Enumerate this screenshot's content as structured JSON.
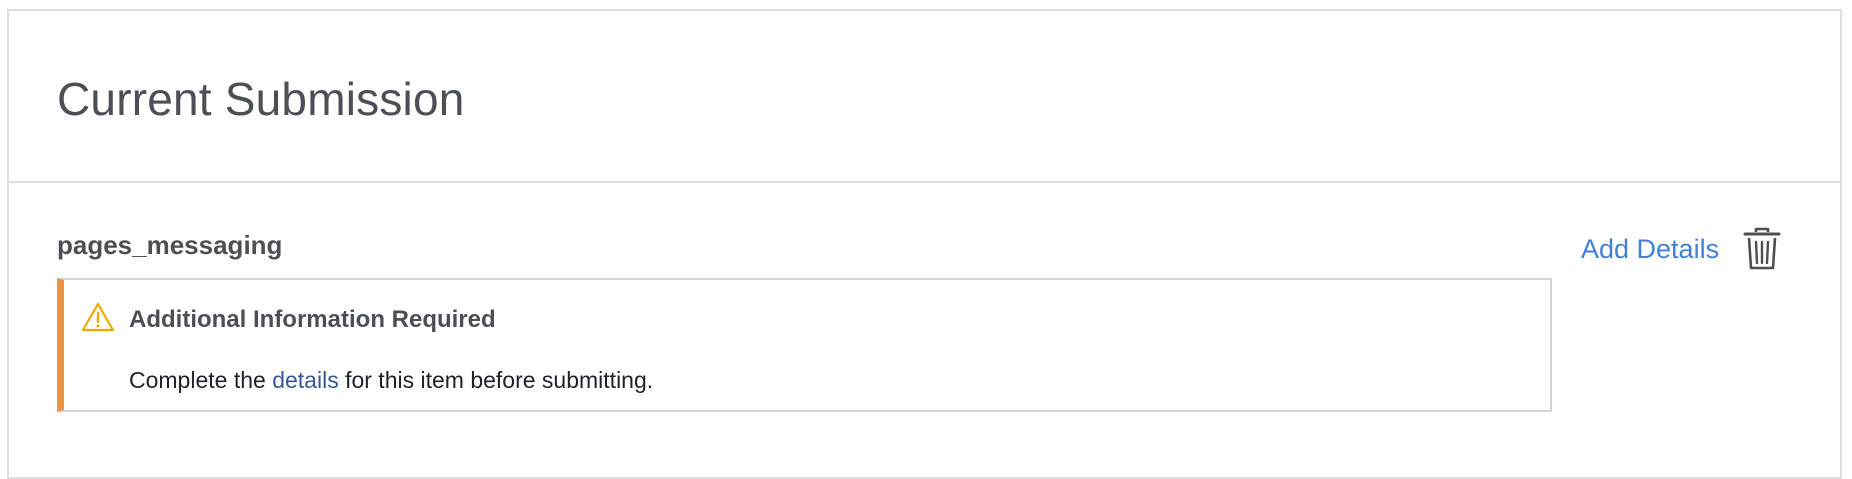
{
  "header": {
    "title": "Current Submission"
  },
  "item": {
    "name": "pages_messaging",
    "notice": {
      "icon": "warning-icon",
      "title": "Additional Information Required",
      "body_before": "Complete the ",
      "body_link": "details",
      "body_after": " for this item before submitting."
    },
    "actions": {
      "add_details_label": "Add Details",
      "delete_icon": "trash-icon"
    }
  },
  "colors": {
    "warning_accent": "#e8954a",
    "link": "#4080d8",
    "inline_link": "#365899",
    "text": "#4b4f56"
  }
}
